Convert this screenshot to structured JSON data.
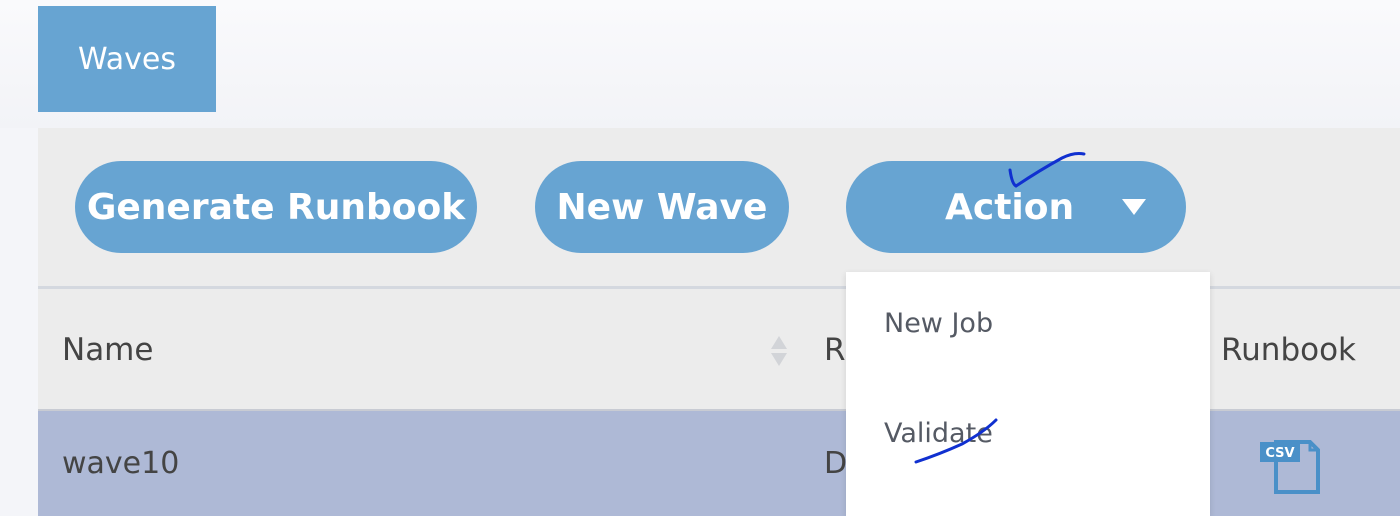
{
  "tabs": [
    {
      "label": "Waves"
    }
  ],
  "toolbar": {
    "generate_runbook_label": "Generate Runbook",
    "new_wave_label": "New Wave",
    "action_label": "Action"
  },
  "action_menu": {
    "items": [
      {
        "label": "New Job"
      },
      {
        "label": "Validate"
      }
    ]
  },
  "table": {
    "columns": [
      "Name",
      "R",
      "Runbook"
    ],
    "rows": [
      {
        "name": "wave10",
        "col2_partial": "D",
        "runbook_icon": "csv-file-icon"
      }
    ]
  },
  "colors": {
    "accent": "#67a4d2",
    "selected_row": "#aeb9d6",
    "annotation_ink": "#1030d0"
  }
}
